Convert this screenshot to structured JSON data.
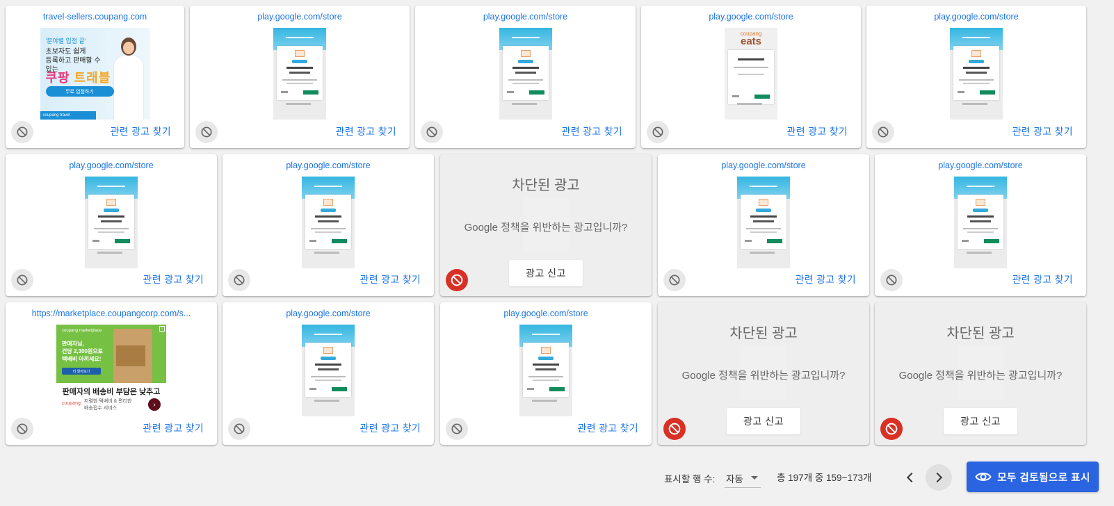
{
  "card_action_label": "관련 광고 찾기",
  "blocked": {
    "title": "차단된 광고",
    "question": "Google 정책을 위반하는 광고입니까?",
    "report_label": "광고 신고"
  },
  "cards": [
    {
      "url": "travel-sellers.coupang.com",
      "creative": "coupang-travel-banner"
    },
    {
      "url": "play.google.com/store",
      "creative": "app-screenshot"
    },
    {
      "url": "play.google.com/store",
      "creative": "app-screenshot"
    },
    {
      "url": "play.google.com/store",
      "creative": "coupang-eats-screenshot"
    },
    {
      "url": "play.google.com/store",
      "creative": "app-screenshot"
    },
    {
      "url": "play.google.com/store",
      "creative": "app-screenshot"
    },
    {
      "url": "play.google.com/store",
      "creative": "app-screenshot"
    },
    {
      "status": "blocked"
    },
    {
      "url": "play.google.com/store",
      "creative": "app-screenshot"
    },
    {
      "url": "play.google.com/store",
      "creative": "app-screenshot"
    },
    {
      "url": "https://marketplace.coupangcorp.com/s...",
      "creative": "coupang-marketplace-banner"
    },
    {
      "url": "play.google.com/store",
      "creative": "app-screenshot"
    },
    {
      "url": "play.google.com/store",
      "creative": "app-screenshot"
    },
    {
      "status": "blocked"
    },
    {
      "status": "blocked"
    }
  ],
  "ad_travel": {
    "tag": "'분야별 입점 끝'",
    "line1": "초보자도 쉽게",
    "line2": "등록하고 판매할 수 있는",
    "brand_a": "쿠팡 ",
    "brand_b": "트래블",
    "cta": "무료 입점하기",
    "footer": "coupang travel"
  },
  "ad_eats": {
    "small": "coupang",
    "big": "eats"
  },
  "ad_market": {
    "brand": "coupang marketplace",
    "line1": "판매자님,",
    "line2": "건당 2,300원으로",
    "line3": "택배비 아끼세요!",
    "cta": "더 알아보기",
    "ad_mark": "i",
    "headline": "판매자의 배송비 부담은 낮추고",
    "logo": "coupang",
    "desc1": "저렴한 택배비 & 편리한",
    "desc2": "배송접수 서비스",
    "go": "›"
  },
  "footer": {
    "rows_label": "표시할 행 수:",
    "rows_value": "자동",
    "range": "총 197개 중 159~173개",
    "mark_all_label": "모두 검토됨으로 표시"
  },
  "colors": {
    "link": "#1a73e8",
    "primary": "#2b64e0",
    "blocked_red": "#d93025"
  },
  "icons": {
    "block": "block-icon",
    "prev": "chevron-left-icon",
    "next": "chevron-right-icon",
    "view": "eye-icon"
  }
}
